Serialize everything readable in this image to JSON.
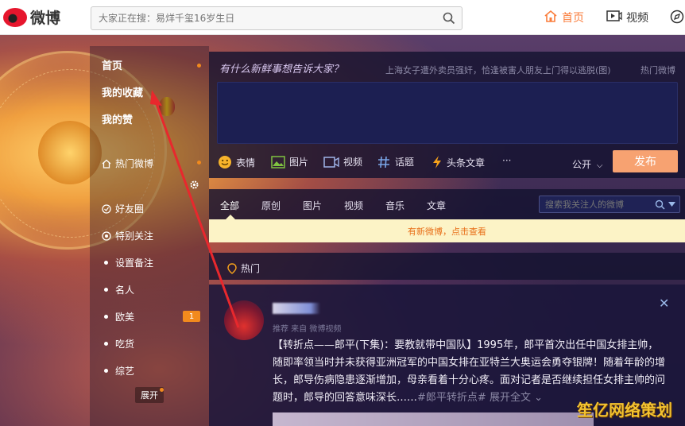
{
  "topbar": {
    "logo_text": "微博",
    "search": {
      "placeholder": "大家正在搜：易烊千玺16岁生日"
    },
    "nav": {
      "home": "首页",
      "video": "视频"
    },
    "accent_color": "#fa7d3c"
  },
  "leftnav": {
    "top_items": [
      {
        "label": "首页"
      },
      {
        "label": "我的收藏"
      },
      {
        "label": "我的赞"
      }
    ],
    "hot_weibo": "热门微博",
    "groups": [
      {
        "label": "好友圈",
        "icon": "friends-icon"
      },
      {
        "label": "特别关注",
        "icon": "star-follow-icon"
      },
      {
        "label": "设置备注",
        "icon": "dot"
      },
      {
        "label": "名人",
        "icon": "dot"
      },
      {
        "label": "欧美",
        "icon": "dot",
        "badge": "1"
      },
      {
        "label": "吃货",
        "icon": "dot"
      },
      {
        "label": "综艺",
        "icon": "dot"
      }
    ],
    "expand_label": "展开"
  },
  "composer": {
    "prompt": "有什么新鲜事想告诉大家？",
    "hot_tip": "上海女子遭外卖员强奸，恰逢被害人朋友上门得以逃脱(图)",
    "hot_link": "热门微博",
    "tools": [
      {
        "label": "表情",
        "icon": "smiley-icon"
      },
      {
        "label": "图片",
        "icon": "image-icon"
      },
      {
        "label": "视频",
        "icon": "video-icon"
      },
      {
        "label": "话题",
        "icon": "hashtag-icon"
      },
      {
        "label": "头条文章",
        "icon": "article-icon"
      }
    ],
    "more": "···",
    "visibility": "公开",
    "post_label": "发布"
  },
  "feed": {
    "tabs": [
      "全部",
      "原创",
      "图片",
      "视频",
      "音乐",
      "文章"
    ],
    "active_tab": "全部",
    "search_placeholder": "搜索我关注人的微博",
    "new_feed_notice": "有新微博，点击查看",
    "hot_section": "热门"
  },
  "post": {
    "meta": "推荐 来自 微博视频",
    "text": "【转折点——郎平(下集)：要教就带中国队】1995年，郎平首次出任中国女排主帅，随即率领当时并未获得亚洲冠军的中国女排在亚特兰大奥运会勇夺银牌！随着年龄的增长，郎导伤病隐患逐渐增加，母亲看着十分心疼。面对记者是否继续担任女排主帅的问题时，郎导的回答意味深长……",
    "tag": "#郎平转折点#",
    "expand": "展开全文 ⌄",
    "close": "✕"
  },
  "watermark": "笙亿网络策划"
}
